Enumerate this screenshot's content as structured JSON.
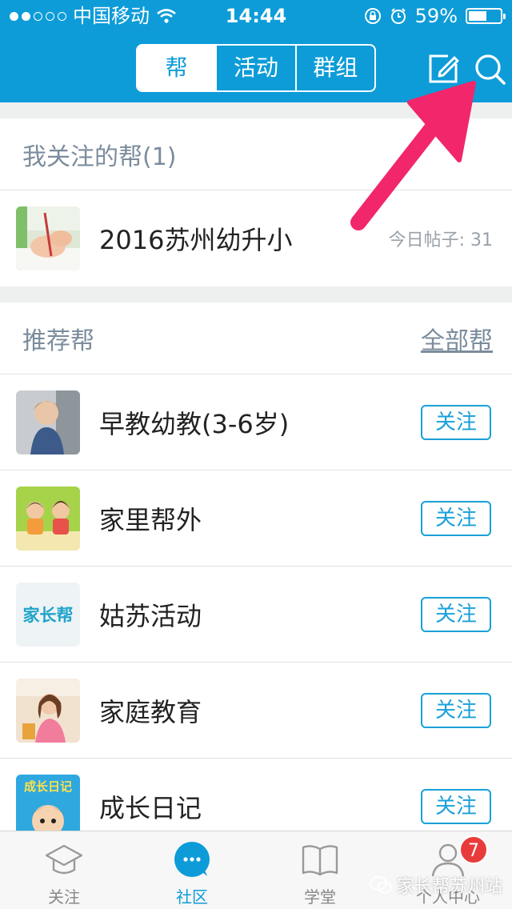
{
  "status_bar": {
    "carrier": "中国移动",
    "time": "14:44",
    "battery": "59%",
    "battery_level": 0.59
  },
  "header": {
    "tabs": [
      {
        "label": "帮",
        "active": true
      },
      {
        "label": "活动",
        "active": false
      },
      {
        "label": "群组",
        "active": false
      }
    ],
    "compose_icon": "compose-icon",
    "search_icon": "search-icon"
  },
  "followed": {
    "title": "我关注的帮(1)",
    "items": [
      {
        "name": "2016苏州幼升小",
        "meta": "今日帖子: 31"
      }
    ]
  },
  "recommended": {
    "title": "推荐帮",
    "all_link": "全部帮",
    "follow_label": "关注",
    "items": [
      {
        "name": "早教幼教(3-6岁)"
      },
      {
        "name": "家里帮外"
      },
      {
        "name": "姑苏活动",
        "logo_text": "家长帮"
      },
      {
        "name": "家庭教育"
      },
      {
        "name": "成长日记",
        "logo_text": "成长日记"
      }
    ]
  },
  "tabbar": {
    "items": [
      {
        "label": "关注",
        "icon": "graduation-cap-icon"
      },
      {
        "label": "社区",
        "icon": "chat-bubble-icon",
        "active": true
      },
      {
        "label": "学堂",
        "icon": "book-icon"
      },
      {
        "label": "个人中心",
        "icon": "person-icon",
        "badge": "7"
      }
    ]
  },
  "watermark": "家长帮苏州站",
  "colors": {
    "primary": "#0d9cd8",
    "badge": "#e83c3c",
    "arrow": "#f2266b"
  }
}
